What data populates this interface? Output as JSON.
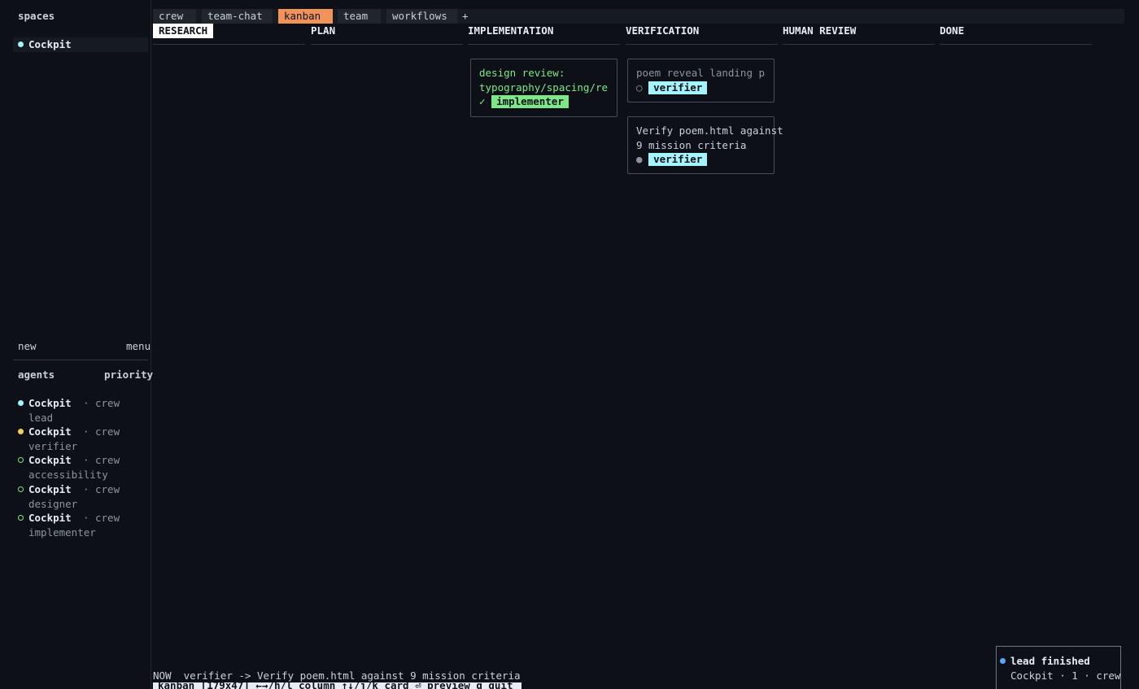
{
  "sidebar": {
    "spaces_label": "spaces",
    "spaces": [
      {
        "name": "Cockpit",
        "status_color": "#a5f3fc"
      }
    ],
    "new_label": "new",
    "menu_label": "menu",
    "agents_label": "agents",
    "priority_label": "priority",
    "agents": [
      {
        "space": "Cockpit",
        "team": "crew",
        "role": "lead",
        "status": "active",
        "color": "#a5f3fc"
      },
      {
        "space": "Cockpit",
        "team": "crew",
        "role": "verifier",
        "status": "busy",
        "color": "#f2cc60"
      },
      {
        "space": "Cockpit",
        "team": "crew",
        "role": "accessibility",
        "status": "idle",
        "color": "#7ee787"
      },
      {
        "space": "Cockpit",
        "team": "crew",
        "role": "designer",
        "status": "idle",
        "color": "#7ee787"
      },
      {
        "space": "Cockpit",
        "team": "crew",
        "role": "implementer",
        "status": "idle",
        "color": "#7ee787"
      }
    ],
    "separator": "·"
  },
  "tabs": [
    {
      "label": "crew",
      "active": false
    },
    {
      "label": "team-chat",
      "active": false
    },
    {
      "label": "kanban",
      "active": true
    },
    {
      "label": "team",
      "active": false
    },
    {
      "label": "workflows",
      "active": false
    }
  ],
  "add_tab_label": "+",
  "columns": [
    {
      "name": "RESEARCH",
      "selected": true
    },
    {
      "name": "PLAN",
      "selected": false
    },
    {
      "name": "IMPLEMENTATION",
      "selected": false
    },
    {
      "name": "VERIFICATION",
      "selected": false
    },
    {
      "name": "HUMAN REVIEW",
      "selected": false
    },
    {
      "name": "DONE",
      "selected": false
    }
  ],
  "cards": {
    "impl_1": {
      "title_line1": "design review:",
      "title_line2": "typography/spacing/resp…",
      "status_glyph": "✓",
      "assignee": "implementer",
      "text_color": "#7ee787",
      "chip_color": "#7ee787"
    },
    "verif_1": {
      "title": "poem reveal landing page",
      "status_glyph": "○",
      "assignee": "verifier",
      "text_color": "#8b949e",
      "chip_color": "#a5f3fc"
    },
    "verif_2": {
      "title_line1": "Verify poem.html against",
      "title_line2": "9 mission criteria",
      "status_glyph": "●",
      "assignee": "verifier",
      "text_color": "#c9d1d9",
      "chip_color": "#a5f3fc"
    }
  },
  "now_bar": {
    "label": "NOW",
    "text": "verifier -> Verify poem.html against 9 mission criteria"
  },
  "status_bar": {
    "text": "kanban  [179x47]  ←→/h/l column  ↑↓/j/k card  ⏎ preview  q quit"
  },
  "notification": {
    "title": "lead finished",
    "detail": "Cockpit · 1 · crew",
    "dot_color": "#58a6ff"
  }
}
